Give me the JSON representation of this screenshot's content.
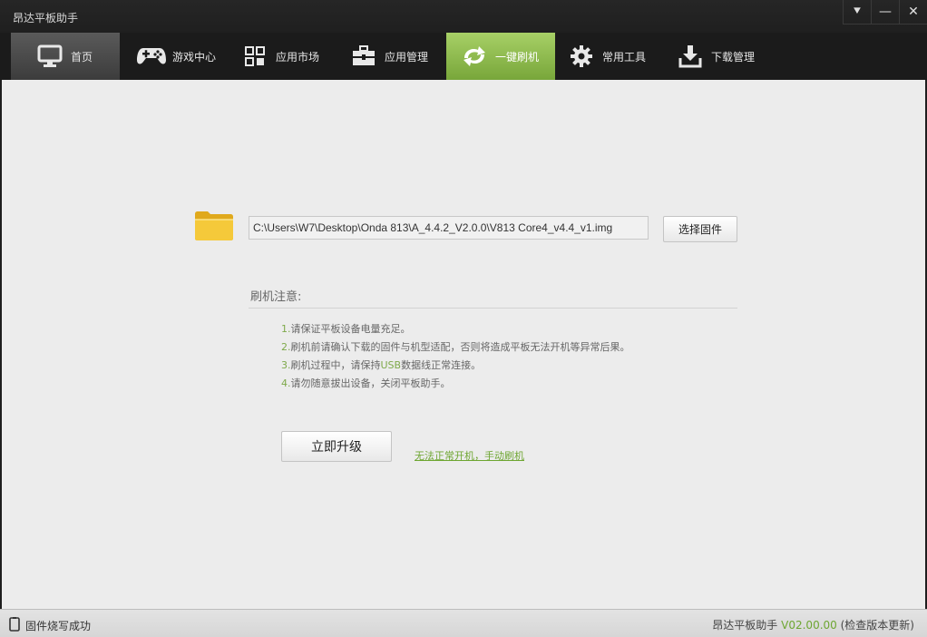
{
  "window": {
    "title": "昂达平板助手",
    "controls": [
      {
        "name": "menu-dropdown-icon",
        "glyph": "⯆"
      },
      {
        "name": "minimize-icon",
        "glyph": "—"
      },
      {
        "name": "close-icon",
        "glyph": "✕"
      }
    ]
  },
  "nav": {
    "items": [
      {
        "label": "首页",
        "icon": "monitor-icon"
      },
      {
        "label": "游戏中心",
        "icon": "gamepad-icon"
      },
      {
        "label": "应用市场",
        "icon": "grid-icon"
      },
      {
        "label": "应用管理",
        "icon": "toolbox-icon"
      },
      {
        "label": "一键刷机",
        "icon": "refresh-arrows-icon"
      },
      {
        "label": "常用工具",
        "icon": "gear-icon"
      },
      {
        "label": "下载管理",
        "icon": "download-icon"
      }
    ],
    "active_index": 4,
    "active_color": "#8dba4e"
  },
  "firmware": {
    "path": "C:\\Users\\W7\\Desktop\\Onda 813\\A_4.4.2_V2.0.0\\V813 Core4_v4.4_v1.img",
    "select_label": "选择固件",
    "folder_icon": "folder-icon",
    "folder_color": "#f2c230"
  },
  "notes": {
    "title": "刷机注意:",
    "items": [
      {
        "num": "1.",
        "text": "请保证平板设备电量充足。"
      },
      {
        "num": "2.",
        "text": "刷机前请确认下载的固件与机型适配，否则将造成平板无法开机等异常后果。"
      },
      {
        "num": "3.",
        "pre": "刷机过程中，请保持",
        "usb": "USB",
        "post": "数据线正常连接。"
      },
      {
        "num": "4.",
        "text": "请勿随意拔出设备，关闭平板助手。"
      }
    ]
  },
  "actions": {
    "upgrade_label": "立即升级",
    "manual_link": "无法正常开机，手动刷机",
    "link_color": "#6ea632"
  },
  "status": {
    "message": "固件烧写成功",
    "app_name": "昂达平板助手",
    "version": "V02.00.00",
    "check_update": "(检查版本更新)",
    "icon": "device-icon"
  }
}
